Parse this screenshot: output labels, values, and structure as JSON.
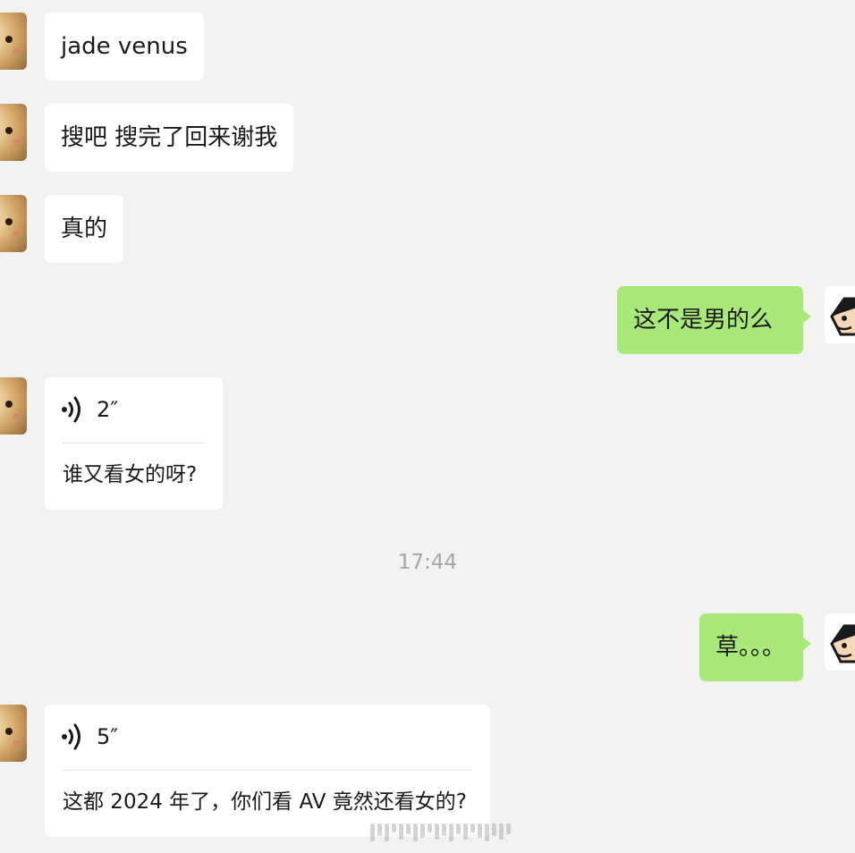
{
  "messages": {
    "m1": "jade venus",
    "m2": "搜吧 搜完了回来谢我",
    "m3": "真的",
    "m4": "这不是男的么",
    "v1": {
      "duration": "2″",
      "transcript": "谁又看女的呀?"
    },
    "time": "17:44",
    "m5": "草。。。",
    "v2": {
      "duration": "5″",
      "transcript": "这都 2024 年了，你们看 AV 竟然还看女的?"
    }
  },
  "colors": {
    "background": "#f2f2f2",
    "incoming_bubble": "#ffffff",
    "outgoing_bubble": "#a9e97a",
    "timestamp": "#a6a6a6"
  },
  "icons": [
    "voice-wave-icon",
    "cat-avatar",
    "cartoon-avatar"
  ]
}
